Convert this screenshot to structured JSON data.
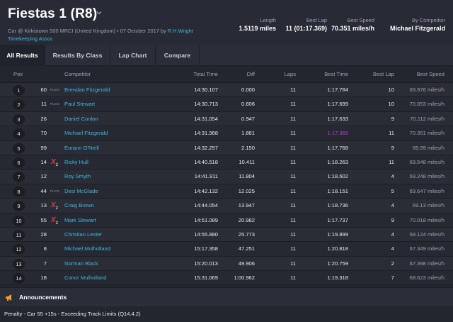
{
  "header": {
    "title": "Fiestas 1 (R8)",
    "subtitle_main": "Car @ Kirkistown 500 MRCI (United Kingdom) • 07 October 2017 by",
    "subtitle_link": "R.H.Wright Timekeeping Assoc",
    "stats": {
      "length_label": "Length",
      "length_value": "1.5119 miles",
      "best_lap_label": "Best Lap",
      "best_lap_value": "11 (01:17.369)",
      "best_speed_label": "Best Speed",
      "best_speed_value": "70.351 miles/h",
      "by_competitor_label": "By Competitor",
      "by_competitor_value": "Michael Fitzgerald"
    }
  },
  "tabs": [
    {
      "label": "All Results",
      "active": true
    },
    {
      "label": "Results By Class",
      "active": false
    },
    {
      "label": "Lap Chart",
      "active": false
    },
    {
      "label": "Compare",
      "active": false
    }
  ],
  "columns": {
    "pos": "Pos",
    "competitor": "Competitor",
    "total_time": "Total Time",
    "diff": "Diff",
    "laps": "Laps",
    "best_time": "Best Time",
    "best_lap": "Best Lap",
    "best_speed": "Best Speed"
  },
  "rows": [
    {
      "pos": "1",
      "num": "60",
      "tag": "PLEG",
      "competitor": "Brendan Fitzgerald",
      "total": "14:30.107",
      "diff": "0.000",
      "laps": "11",
      "best_time": "1:17.784",
      "best_lap": "10",
      "best_speed": "69.976 miles/h"
    },
    {
      "pos": "2",
      "num": "11",
      "tag": "PLEG",
      "competitor": "Paul Stewart",
      "total": "14:30.713",
      "diff": "0.606",
      "laps": "11",
      "best_time": "1:17.699",
      "best_lap": "10",
      "best_speed": "70.053 miles/h"
    },
    {
      "pos": "3",
      "num": "26",
      "tag": "",
      "competitor": "Daniel Conlon",
      "total": "14:31.054",
      "diff": "0.947",
      "laps": "11",
      "best_time": "1:17.633",
      "best_lap": "9",
      "best_speed": "70.112 miles/h"
    },
    {
      "pos": "4",
      "num": "70",
      "tag": "",
      "competitor": "Michael Fitzgerald",
      "total": "14:31.968",
      "diff": "1.861",
      "laps": "11",
      "best_time": "1:17.369",
      "best_time_purple": true,
      "best_lap": "11",
      "best_speed": "70.351 miles/h"
    },
    {
      "pos": "5",
      "num": "99",
      "tag": "",
      "competitor": "Eorann O'Neill",
      "total": "14:32.257",
      "diff": "2.150",
      "laps": "11",
      "best_time": "1:17.768",
      "best_lap": "9",
      "best_speed": "69.99 miles/h"
    },
    {
      "pos": "6",
      "num": "14",
      "tag": "",
      "penalty": "X",
      "penalty_sub": "2",
      "competitor": "Ricky Hull",
      "total": "14:40.518",
      "diff": "10.411",
      "laps": "11",
      "best_time": "1:18.263",
      "best_lap": "11",
      "best_speed": "69.548 miles/h"
    },
    {
      "pos": "7",
      "num": "12",
      "tag": "",
      "competitor": "Roy Smyth",
      "total": "14:41.911",
      "diff": "11.804",
      "laps": "11",
      "best_time": "1:18.602",
      "best_lap": "4",
      "best_speed": "69.248 miles/h"
    },
    {
      "pos": "8",
      "num": "44",
      "tag": "PLEG",
      "competitor": "Desi McGlade",
      "total": "14:42.132",
      "diff": "12.025",
      "laps": "11",
      "best_time": "1:18.151",
      "best_lap": "5",
      "best_speed": "69.647 miles/h"
    },
    {
      "pos": "9",
      "num": "13",
      "tag": "",
      "penalty": "X",
      "penalty_sub": "2",
      "competitor": "Craig Brown",
      "total": "14:44.054",
      "diff": "13.947",
      "laps": "11",
      "best_time": "1:18.736",
      "best_lap": "4",
      "best_speed": "69.13 miles/h"
    },
    {
      "pos": "10",
      "num": "55",
      "tag": "",
      "penalty": "X",
      "penalty_sub": "2",
      "competitor": "Mark Stewart",
      "total": "14:51.089",
      "diff": "20.982",
      "laps": "11",
      "best_time": "1:17.737",
      "best_lap": "9",
      "best_speed": "70.018 miles/h"
    },
    {
      "pos": "11",
      "num": "28",
      "tag": "",
      "competitor": "Christian Lester",
      "total": "14:55.880",
      "diff": "25.773",
      "laps": "11",
      "best_time": "1:19.899",
      "best_lap": "4",
      "best_speed": "68.124 miles/h"
    },
    {
      "pos": "12",
      "num": "8",
      "tag": "",
      "competitor": "Michael Mulholland",
      "total": "15:17.358",
      "diff": "47.251",
      "laps": "11",
      "best_time": "1:20.818",
      "best_lap": "4",
      "best_speed": "67.349 miles/h"
    },
    {
      "pos": "13",
      "num": "7",
      "tag": "",
      "competitor": "Norman Black",
      "total": "15:20.013",
      "diff": "49.906",
      "laps": "11",
      "best_time": "1:20.759",
      "best_lap": "2",
      "best_speed": "67.398 miles/h"
    },
    {
      "pos": "14",
      "num": "18",
      "tag": "",
      "competitor": "Conor Mulholland",
      "total": "15:31.069",
      "diff": "1:00.962",
      "laps": "11",
      "best_time": "1:19.318",
      "best_lap": "7",
      "best_speed": "68.623 miles/h"
    }
  ],
  "announcements": {
    "icon": "megaphone-icon",
    "title": "Announcements",
    "text": "Penalty - Car 55 +15s - Exceeding Track Limits (Q14.4.2)",
    "accent": "#f0a020"
  },
  "colors": {
    "link": "#3fb5de",
    "purple_best": "#b23bd8",
    "penalty": "#e23b3b"
  }
}
